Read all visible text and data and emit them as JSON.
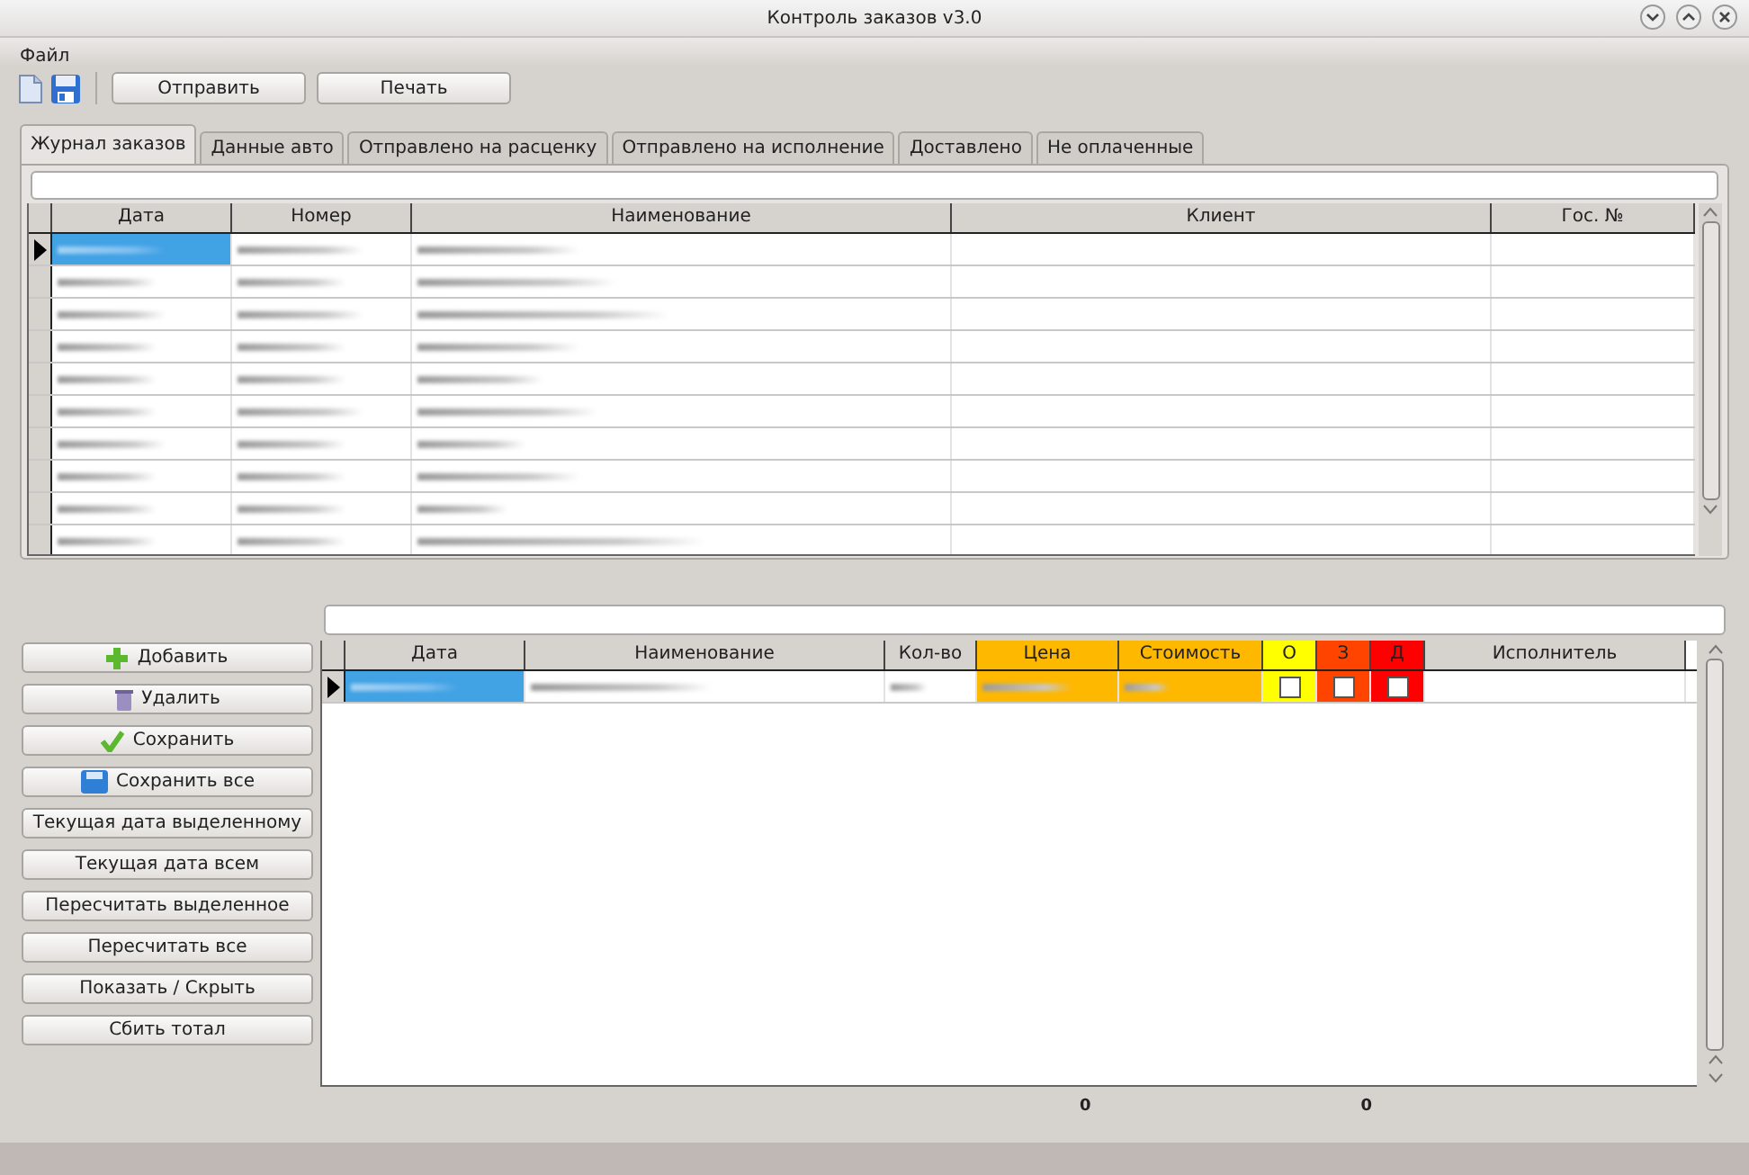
{
  "window": {
    "title": "Контроль заказов v3.0"
  },
  "menu": [
    "Файл"
  ],
  "toolbar": {
    "buttons": [
      "Отправить",
      "Печать"
    ]
  },
  "tabs": [
    {
      "label": "Журнал заказов",
      "selected": true
    },
    {
      "label": "Данные авто",
      "selected": false
    },
    {
      "label": "Отправлено на расценку",
      "selected": false
    },
    {
      "label": "Отправлено на исполнение",
      "selected": false
    },
    {
      "label": "Доставлено",
      "selected": false
    },
    {
      "label": "Не оплаченные",
      "selected": false
    }
  ],
  "orders": {
    "columns": [
      "Дата",
      "Номер",
      "Наименование",
      "Клиент",
      "Гос. №"
    ],
    "rows": [
      {
        "selected": true
      },
      {
        "selected": false
      },
      {
        "selected": false
      },
      {
        "selected": false
      },
      {
        "selected": false
      },
      {
        "selected": false
      },
      {
        "selected": false
      },
      {
        "selected": false
      },
      {
        "selected": false
      },
      {
        "selected": false
      }
    ]
  },
  "actions": [
    {
      "label": "Добавить",
      "kind": "add"
    },
    {
      "label": "Удалить",
      "kind": "delete"
    },
    {
      "label": "Сохранить",
      "kind": "save"
    },
    {
      "label": "Сохранить все",
      "kind": "saveall"
    },
    {
      "label": "Текущая дата выделенному",
      "kind": "plain"
    },
    {
      "label": "Текущая дата всем",
      "kind": "plain"
    },
    {
      "label": "Пересчитать выделенное",
      "kind": "plain"
    },
    {
      "label": "Пересчитать все",
      "kind": "plain"
    },
    {
      "label": "Показать / Скрыть",
      "kind": "plain"
    },
    {
      "label": "Сбить тотал",
      "kind": "plain"
    }
  ],
  "items": {
    "columns": [
      {
        "label": "Дата",
        "color": "#d6d2ce"
      },
      {
        "label": "Наименование",
        "color": "#d6d2ce"
      },
      {
        "label": "Кол-во",
        "color": "#d6d2ce"
      },
      {
        "label": "Цена",
        "color": "#ffb800"
      },
      {
        "label": "Стоимость",
        "color": "#ffb800"
      },
      {
        "label": "О",
        "color": "#ffff00"
      },
      {
        "label": "З",
        "color": "#ff4400"
      },
      {
        "label": "Д",
        "color": "#ff0000"
      },
      {
        "label": "Исполнитель",
        "color": "#d6d2ce"
      }
    ],
    "rows": [
      {
        "selected": true,
        "checks": [
          false,
          false,
          false
        ]
      }
    ],
    "totals": [
      "0",
      "0"
    ]
  }
}
